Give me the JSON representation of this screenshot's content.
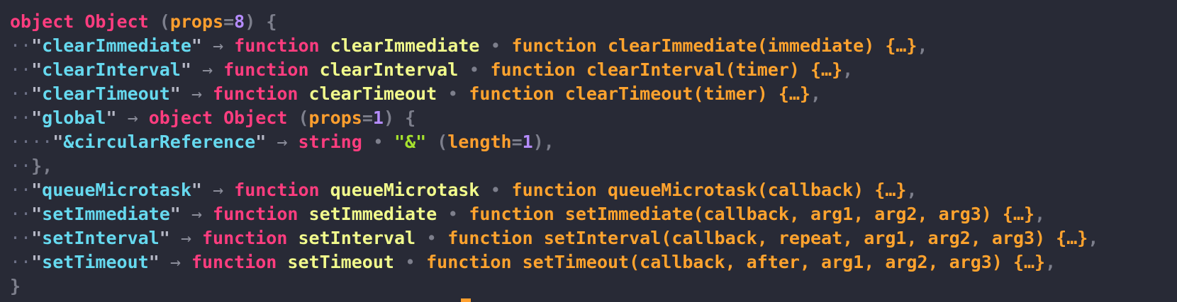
{
  "root": {
    "open": {
      "keyword": "object",
      "type_name": "Object",
      "paren_open": "(",
      "meta_label": "props",
      "eq": "=",
      "count": "8",
      "paren_close": ")",
      "brace": "{"
    },
    "entries": [
      {
        "indent": "··",
        "key": "clearImmediate",
        "fn_keyword": "function",
        "fn_name": "clearImmediate",
        "bullet": "•",
        "source": "function clearImmediate(immediate) {…}",
        "trail": ","
      },
      {
        "indent": "··",
        "key": "clearInterval",
        "fn_keyword": "function",
        "fn_name": "clearInterval",
        "bullet": "•",
        "source": "function clearInterval(timer) {…}",
        "trail": ","
      },
      {
        "indent": "··",
        "key": "clearTimeout",
        "fn_keyword": "function",
        "fn_name": "clearTimeout",
        "bullet": "•",
        "source": "function clearTimeout(timer) {…}",
        "trail": ","
      }
    ],
    "global": {
      "indent": "··",
      "key": "global",
      "keyword": "object",
      "type_name": "Object",
      "meta_label": "props",
      "count": "1",
      "brace": "{",
      "child": {
        "indent": "····",
        "key": "&circularReference",
        "type": "string",
        "bullet": "•",
        "value": "\"&\"",
        "meta_label": "length",
        "count": "1",
        "trail": ","
      },
      "close_indent": "··",
      "close": "},"
    },
    "entries_after": [
      {
        "indent": "··",
        "key": "queueMicrotask",
        "fn_keyword": "function",
        "fn_name": "queueMicrotask",
        "bullet": "•",
        "source": "function queueMicrotask(callback) {…}",
        "trail": ","
      },
      {
        "indent": "··",
        "key": "setImmediate",
        "fn_keyword": "function",
        "fn_name": "setImmediate",
        "bullet": "•",
        "source": "function setImmediate(callback, arg1, arg2, arg3) {…}",
        "trail": ","
      },
      {
        "indent": "··",
        "key": "setInterval",
        "fn_keyword": "function",
        "fn_name": "setInterval",
        "bullet": "•",
        "source": "function setInterval(callback, repeat, arg1, arg2, arg3) {…}",
        "trail": ","
      },
      {
        "indent": "··",
        "key": "setTimeout",
        "fn_keyword": "function",
        "fn_name": "setTimeout",
        "bullet": "•",
        "source": "function setTimeout(callback, after, arg1, arg2, arg3) {…}",
        "trail": ","
      }
    ],
    "close": "}"
  },
  "symbols": {
    "quote": "\"",
    "arrow": "→"
  },
  "colors": {
    "background": "#282a36",
    "keyword": "#ff3d7f",
    "key": "#66d9ef",
    "function_name": "#f1fa8c",
    "source": "#ffa32e",
    "number": "#b58cff",
    "string": "#a6e22e",
    "cursor": "#ff9f2e"
  },
  "icons": {
    "cursor": "text-cursor-icon"
  }
}
